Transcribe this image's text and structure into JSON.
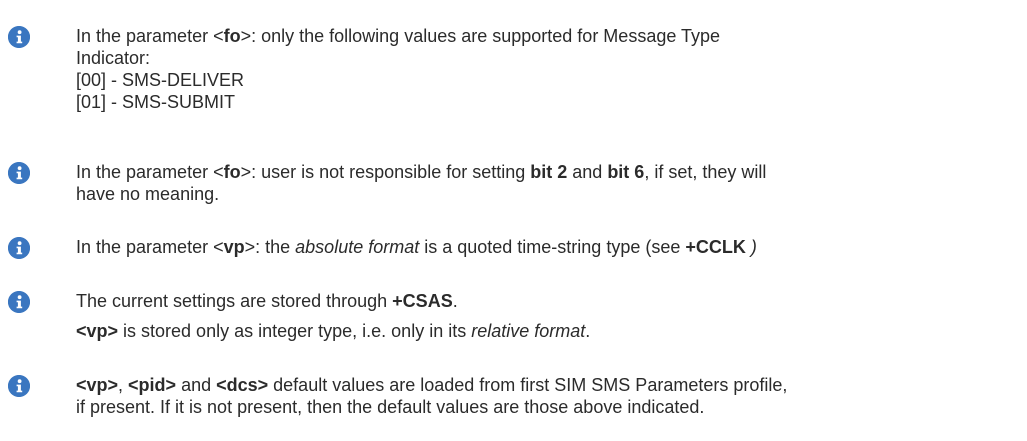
{
  "notes": [
    {
      "icon": "info-icon",
      "lines": [
        {
          "a": "In the parameter <",
          "b": "fo",
          "c": ">: only the following values are supported for Message Type"
        },
        {
          "a": "Indicator:"
        },
        {
          "a": "[00] - SMS-DELIVER"
        },
        {
          "a": "[01] - SMS-SUBMIT"
        }
      ]
    },
    {
      "icon": "info-icon",
      "lines": [
        {
          "a": "In the parameter <",
          "b": "fo",
          "c": ">: user is not responsible for setting ",
          "d": "bit 2",
          "e": " and ",
          "f": "bit 6",
          "g": ", if set, they will"
        },
        {
          "a": "have no meaning."
        }
      ]
    },
    {
      "icon": "info-icon",
      "lines": [
        {
          "a": "In the parameter <",
          "b": "vp",
          "c": ">: the ",
          "d": "absolute format",
          "e": " is a quoted time-string type (see ",
          "f": "+CCLK",
          "g": " )"
        }
      ]
    },
    {
      "icon": "info-icon",
      "lines": [
        {
          "a": "The current settings are stored through ",
          "b": "+CSAS",
          "c": "."
        },
        {
          "a": "<vp>",
          "b": " is stored only as integer type, i.e. only in its ",
          "c": "relative format",
          "d": "."
        }
      ]
    },
    {
      "icon": "info-icon",
      "lines": [
        {
          "a": "<vp>",
          "b": ", ",
          "c": "<pid>",
          "d": " and ",
          "e": "<dcs>",
          "f": " default values are loaded from first SIM SMS Parameters profile,"
        },
        {
          "a": "if present. If it is not present, then the default values are those above indicated."
        }
      ]
    }
  ],
  "colors": {
    "icon_fill": "#3a76c0",
    "text": "#2b2b2b"
  }
}
